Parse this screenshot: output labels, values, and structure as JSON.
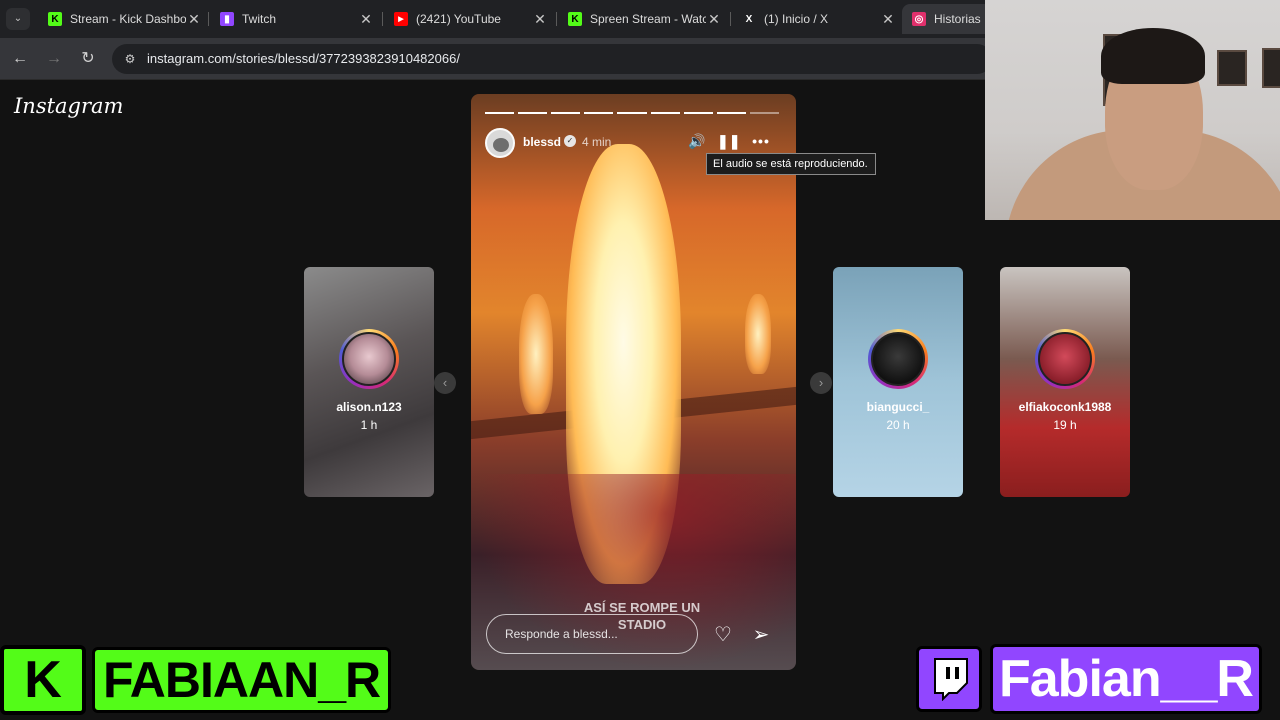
{
  "browser": {
    "tabs": [
      {
        "label": "Stream - Kick Dashboard",
        "icon": "kick-icon",
        "color": "#53fc18",
        "glyph": "K"
      },
      {
        "label": "Twitch",
        "icon": "twitch-icon",
        "color": "#9146ff",
        "glyph": "▮"
      },
      {
        "label": "(2421) YouTube",
        "icon": "youtube-icon",
        "color": "#ff0000",
        "glyph": "▶"
      },
      {
        "label": "Spreen Stream - Watch",
        "icon": "kick-icon",
        "color": "#53fc18",
        "glyph": "K"
      },
      {
        "label": "(1) Inicio / X",
        "icon": "x-icon",
        "color": "#ffffff",
        "glyph": "X"
      },
      {
        "label": "Historias •",
        "icon": "instagram-icon",
        "color": "#e1306c",
        "glyph": "◎"
      }
    ],
    "active_tab": 5,
    "url": "instagram.com/stories/blessd/3772393823910482066/"
  },
  "instagram": {
    "logo": "Instagram"
  },
  "story": {
    "username": "blessd",
    "time": "4 min",
    "tooltip": "El audio se está reproduciendo.",
    "caption": "ASÍ SE ROMPE UN STADIO",
    "reply_placeholder": "Responde a blessd...",
    "segments_total": 9,
    "segments_done": 8
  },
  "side_stories": [
    {
      "username": "alison.n123",
      "time": "1 h"
    },
    {
      "username": "biangucci_",
      "time": "20 h"
    },
    {
      "username": "elfiakoconk1988",
      "time": "19 h"
    }
  ],
  "overlay": {
    "kick_name": "FABIAAN_R",
    "twitch_name": "Fabian__R",
    "kick_color": "#53fc18",
    "twitch_color": "#9146ff"
  }
}
